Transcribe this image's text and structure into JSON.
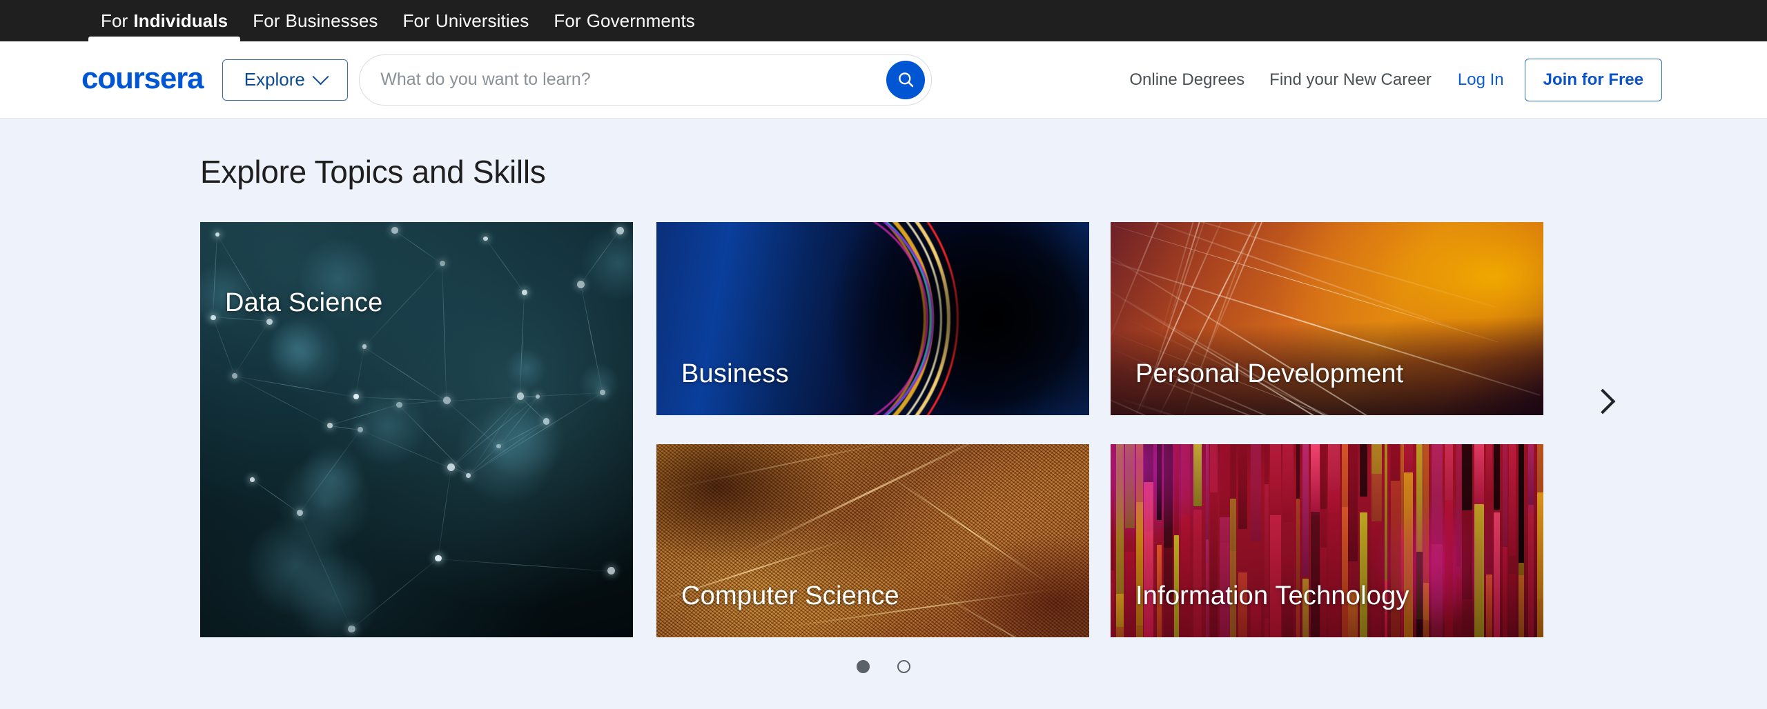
{
  "audience_bar": {
    "tabs": [
      {
        "pre": "For",
        "main": "Individuals",
        "active": true
      },
      {
        "pre": "For",
        "main": "Businesses",
        "active": false
      },
      {
        "pre": "For",
        "main": "Universities",
        "active": false
      },
      {
        "pre": "For",
        "main": "Governments",
        "active": false
      }
    ]
  },
  "header": {
    "logo": "coursera",
    "explore_label": "Explore",
    "explore_icon": "chevron-down-icon",
    "search": {
      "placeholder": "What do you want to learn?",
      "value": "",
      "button_icon": "search-icon"
    },
    "links": [
      {
        "label": "Online Degrees",
        "style": "muted"
      },
      {
        "label": "Find your New Career",
        "style": "muted"
      },
      {
        "label": "Log In",
        "style": "link"
      }
    ],
    "join_label": "Join for Free"
  },
  "main": {
    "title": "Explore Topics and Skills",
    "cards": [
      {
        "label": "Data Science",
        "slot": "ds",
        "theme": "dark-teal-network"
      },
      {
        "label": "Business",
        "slot": "biz",
        "theme": "deep-blue-light-streaks"
      },
      {
        "label": "Personal Development",
        "slot": "pdev",
        "theme": "orange-amber-streaks"
      },
      {
        "label": "Computer Science",
        "slot": "cs",
        "theme": "golden-woven-mesh"
      },
      {
        "label": "Information Technology",
        "slot": "it",
        "theme": "crimson-vertical-bars"
      }
    ],
    "next_arrow_icon": "chevron-right-icon",
    "pagination": {
      "total": 2,
      "active_index": 0
    }
  },
  "colors": {
    "brand_blue": "#0056d2",
    "link_blue": "#0b5cd5",
    "page_bg": "#eef2fa",
    "topbar_bg": "#1f1f1f",
    "header_bg": "#ffffff",
    "text_dark": "#1f1f1f",
    "text_muted": "#4a4f53",
    "dot_color": "#5b6168"
  }
}
